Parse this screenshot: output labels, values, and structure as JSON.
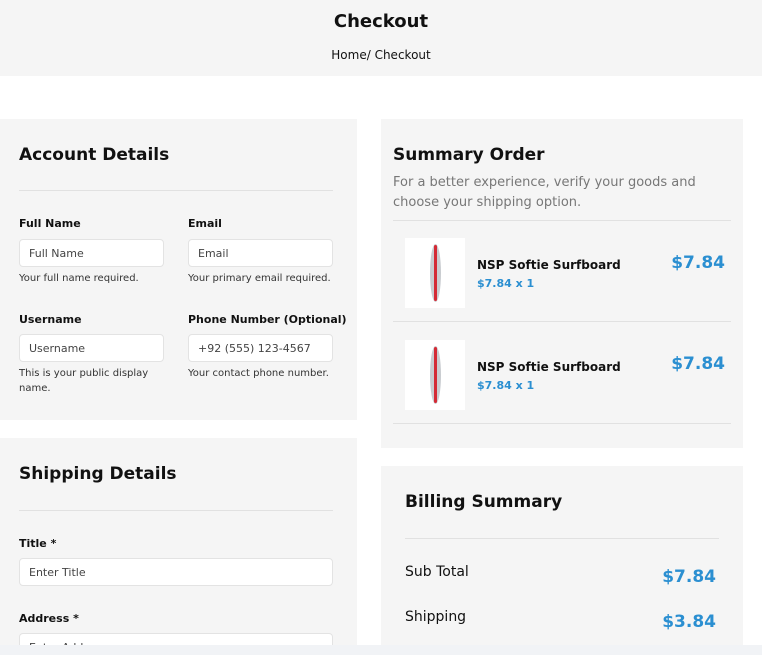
{
  "header": {
    "title": "Checkout",
    "breadcrumb": "Home/ Checkout"
  },
  "account": {
    "title": "Account Details",
    "fields": [
      {
        "label": "Full Name",
        "placeholder": "Full Name",
        "help": "Your full name required."
      },
      {
        "label": "Email",
        "placeholder": "Email",
        "help": "Your primary email required."
      },
      {
        "label": "Username",
        "placeholder": "Username",
        "help_lines": [
          "This is your public display",
          "name."
        ]
      },
      {
        "label": "Phone Number (Optional)",
        "placeholder": "+92 (555) 123-4567",
        "help": "Your contact phone number."
      }
    ]
  },
  "shipping": {
    "title": "Shipping Details",
    "fields": [
      {
        "label": "Title *",
        "placeholder": "Enter Title"
      },
      {
        "label": "Address *",
        "placeholder": "Enter Address"
      }
    ]
  },
  "summary": {
    "title": "Summary Order",
    "subtitle_lines": [
      "For a better experience, verify your goods and",
      "choose your shipping option."
    ],
    "items": [
      {
        "name": "NSP Softie Surfboard",
        "qty": "$7.84 x 1",
        "price": "$7.84"
      },
      {
        "name": "NSP Softie Surfboard",
        "qty": "$7.84 x 1",
        "price": "$7.84"
      }
    ]
  },
  "billing": {
    "title": "Billing Summary",
    "rows": [
      {
        "label": "Sub Total",
        "value": "$7.84"
      },
      {
        "label": "Shipping",
        "value": "$3.84"
      }
    ]
  },
  "colors": {
    "accent": "#2b8fd1",
    "panel": "#f5f5f5",
    "surfboard_stripe": "#d42a35"
  }
}
